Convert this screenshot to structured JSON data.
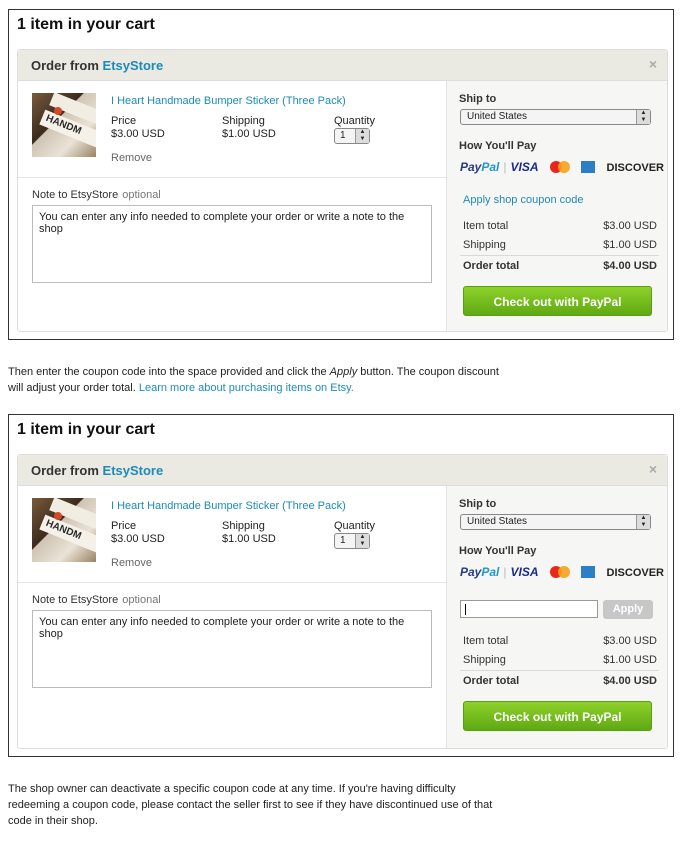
{
  "cart_title": "1 item in your cart",
  "order": {
    "from_label": "Order from",
    "store_name": "EtsyStore",
    "close": "×"
  },
  "item": {
    "title": "I Heart Handmade Bumper Sticker (Three Pack)",
    "price_label": "Price",
    "price": "$3.00 USD",
    "shipping_label": "Shipping",
    "shipping": "$1.00 USD",
    "quantity_label": "Quantity",
    "quantity": "1",
    "remove": "Remove",
    "thumb_text": "HANDM"
  },
  "note": {
    "label": "Note to EtsyStore",
    "optional": "optional",
    "text": "You can enter any info needed to complete your order or write a note to the shop"
  },
  "ship": {
    "label": "Ship to",
    "country": "United States"
  },
  "payment": {
    "label": "How You'll Pay",
    "paypal_a": "Pay",
    "paypal_b": "Pal",
    "visa": "VISA",
    "discover": "DISCOVER"
  },
  "coupon": {
    "link": "Apply shop coupon code",
    "apply": "Apply"
  },
  "summary": {
    "item_total_label": "Item total",
    "item_total": "$3.00 USD",
    "shipping_label": "Shipping",
    "shipping": "$1.00 USD",
    "order_total_label": "Order total",
    "order_total": "$4.00 USD"
  },
  "checkout": "Check out with PayPal",
  "para1": {
    "text_a": "Then enter the coupon code into the space provided and click the ",
    "apply_word": "Apply",
    "text_b": " button.  The coupon discount",
    "text_c": "will adjust your order total. ",
    "link": "Learn more about purchasing items on Etsy."
  },
  "para2": {
    "line1": "The shop owner can deactivate a specific coupon code at any time. If you're having difficulty",
    "line2": "redeeming a coupon code, please contact the seller first to see if they have discontinued use of that",
    "line3": "code in their shop."
  },
  "colors": {
    "link": "#1c8bba",
    "checkout_green": "#5fa913",
    "header_bg": "#eae9e2"
  }
}
